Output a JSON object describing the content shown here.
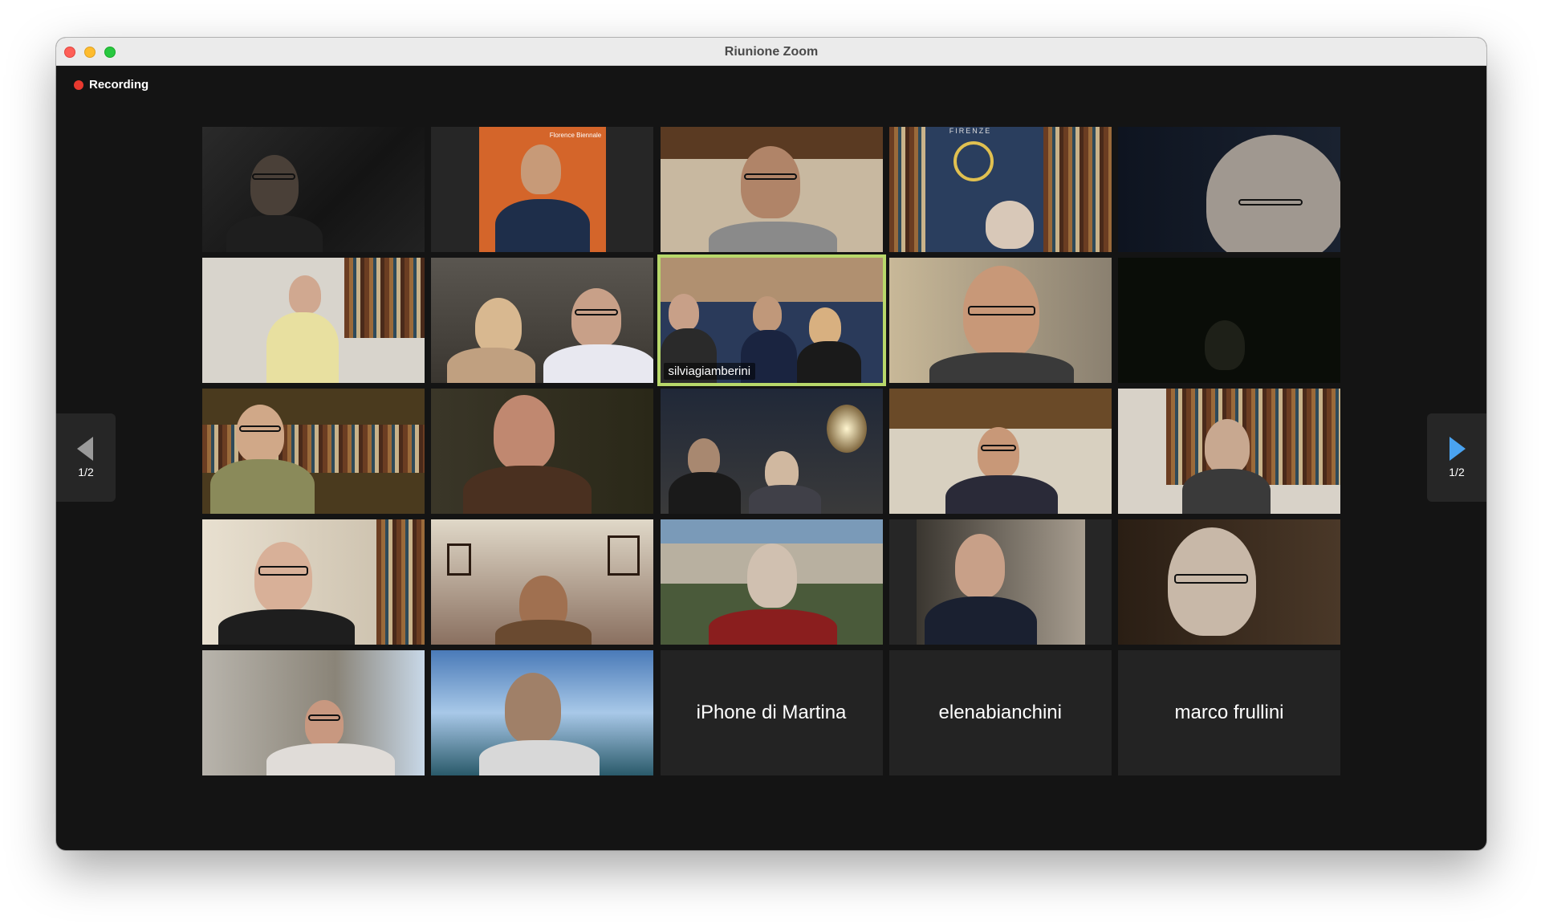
{
  "window": {
    "title": "Riunione Zoom"
  },
  "recording": {
    "label": "Recording",
    "color": "#e8392f"
  },
  "pagination": {
    "prev_label": "1/2",
    "next_label": "1/2",
    "prev_icon": "triangle-left-icon",
    "next_icon": "triangle-right-icon",
    "next_color": "#4aa3f0"
  },
  "participants": [
    {
      "name": "",
      "video": true
    },
    {
      "name": "",
      "video": true,
      "poster_text": "Florence Biennale"
    },
    {
      "name": "",
      "video": true
    },
    {
      "name": "",
      "video": true,
      "background_text": "FIRENZE"
    },
    {
      "name": "",
      "video": true
    },
    {
      "name": "",
      "video": true
    },
    {
      "name": "",
      "video": true
    },
    {
      "name": "silviagiamberini",
      "video": true,
      "active_speaker": true
    },
    {
      "name": "",
      "video": true
    },
    {
      "name": "",
      "video": true
    },
    {
      "name": "",
      "video": true
    },
    {
      "name": "",
      "video": true
    },
    {
      "name": "",
      "video": true
    },
    {
      "name": "",
      "video": true
    },
    {
      "name": "",
      "video": true
    },
    {
      "name": "",
      "video": true
    },
    {
      "name": "",
      "video": true
    },
    {
      "name": "",
      "video": true
    },
    {
      "name": "",
      "video": true
    },
    {
      "name": "",
      "video": true
    },
    {
      "name": "",
      "video": true
    },
    {
      "name": "",
      "video": true
    },
    {
      "name": "iPhone di Martina",
      "video": false
    },
    {
      "name": "elenabianchini",
      "video": false
    },
    {
      "name": "marco frullini",
      "video": false
    }
  ]
}
